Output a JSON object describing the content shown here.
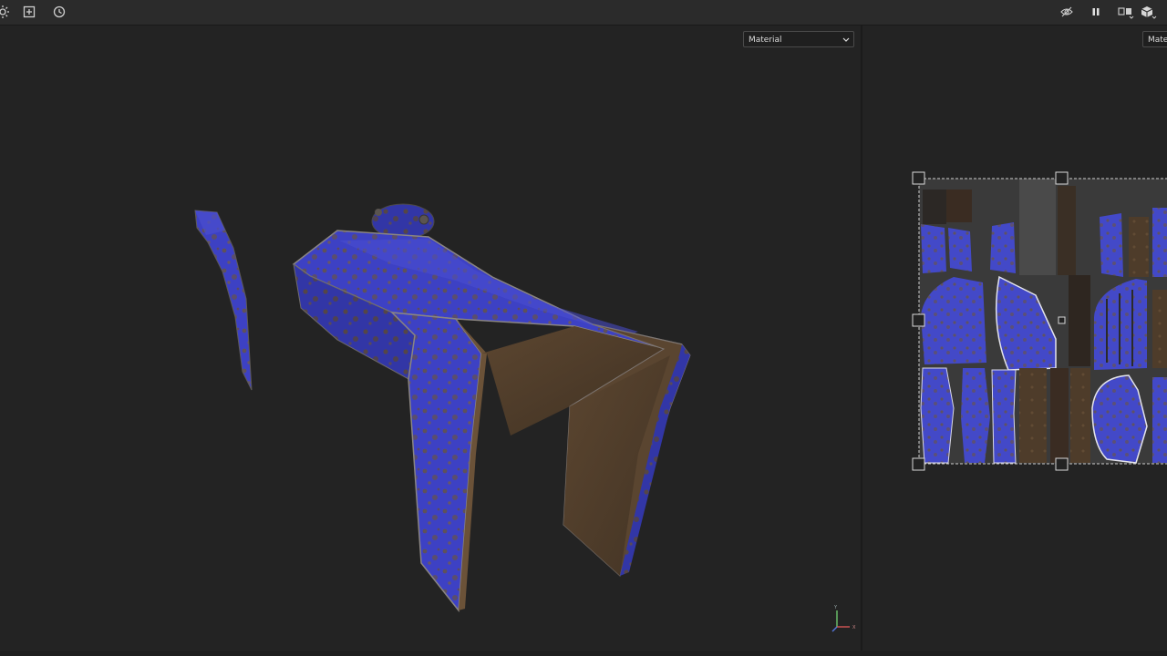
{
  "toolbar": {
    "left_icons": [
      "brightness-icon",
      "add-frame-icon",
      "history-clock-icon"
    ],
    "right_icons": [
      "hide-eye-icon",
      "pause-icon",
      "split-view-icon",
      "cube-view-icon"
    ]
  },
  "viewport3d": {
    "material_dropdown": "Material"
  },
  "viewport2d": {
    "material_dropdown": "Material"
  },
  "axis_gizmo": {
    "y_label": "Y",
    "x_label": "X"
  },
  "colors": {
    "toolbar_bg": "#2b2b2b",
    "viewport_bg": "#232323",
    "paint_blue": "#3d41c4",
    "rust_brown": "#6b4d33"
  }
}
